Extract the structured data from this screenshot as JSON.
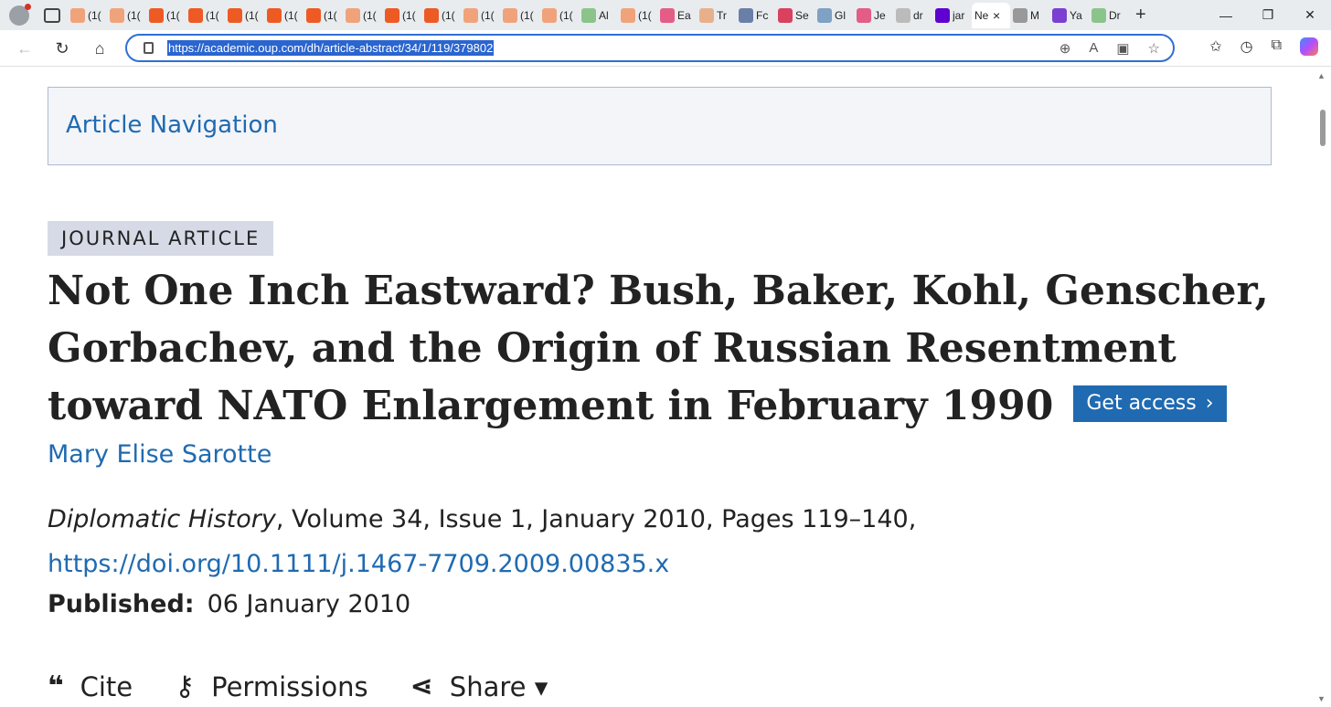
{
  "browser": {
    "tabs": [
      {
        "label": "(1(",
        "color": "#f0a37a"
      },
      {
        "label": "(1(",
        "color": "#f0a37a"
      },
      {
        "label": "(1(",
        "color": "#ee5a24"
      },
      {
        "label": "(1(",
        "color": "#ee5a24"
      },
      {
        "label": "(1(",
        "color": "#ee5a24"
      },
      {
        "label": "(1(",
        "color": "#ee5a24"
      },
      {
        "label": "(1(",
        "color": "#ee5a24"
      },
      {
        "label": "(1(",
        "color": "#f0a37a"
      },
      {
        "label": "(1(",
        "color": "#ee5a24"
      },
      {
        "label": "(1(",
        "color": "#ee5a24"
      },
      {
        "label": "(1(",
        "color": "#f0a37a"
      },
      {
        "label": "(1(",
        "color": "#f0a37a"
      },
      {
        "label": "(1(",
        "color": "#f0a37a"
      },
      {
        "label": "Al",
        "color": "#8bc48a"
      },
      {
        "label": "(1(",
        "color": "#f0a37a"
      },
      {
        "label": "Ea",
        "color": "#e35d86"
      },
      {
        "label": "Tr",
        "color": "#e8b08a"
      },
      {
        "label": "Fc",
        "color": "#6a7fa8"
      },
      {
        "label": "Se",
        "color": "#d9415f"
      },
      {
        "label": "Gl",
        "color": "#7ea1c4"
      },
      {
        "label": "Je",
        "color": "#e35d86"
      },
      {
        "label": "dr",
        "color": "#bbbbbb"
      },
      {
        "label": "jar",
        "color": "#5f01d1"
      }
    ],
    "active_tab": {
      "label": "Ne",
      "close": "×"
    },
    "tabs_after": [
      {
        "label": "M",
        "color": "#999999"
      },
      {
        "label": "Ya",
        "color": "#7b3fd1"
      },
      {
        "label": "Dr",
        "color": "#8bc48a"
      }
    ],
    "url": "https://academic.oup.com/dh/article-abstract/34/1/119/379802"
  },
  "page": {
    "article_navigation": "Article Navigation",
    "badge": "JOURNAL ARTICLE",
    "title": "Not One Inch Eastward? Bush, Baker, Kohl, Genscher, Gorbachev, and the Origin of Russian Resentment toward NATO Enlargement in February 1990",
    "get_access": "Get access",
    "author": "Mary Elise Sarotte",
    "citation": {
      "journal": "Diplomatic History",
      "details": ", Volume 34, Issue 1, January 2010, Pages 119–140, ",
      "doi": "https://doi.org/10.1111/j.1467-7709.2009.00835.x"
    },
    "published_label": "Published:",
    "published_date": "06 January 2010",
    "tools": {
      "cite": "Cite",
      "permissions": "Permissions",
      "share": "Share ▾"
    }
  },
  "icons": {
    "cite": "quote-icon",
    "permissions": "key-icon",
    "share": "share-icon"
  }
}
